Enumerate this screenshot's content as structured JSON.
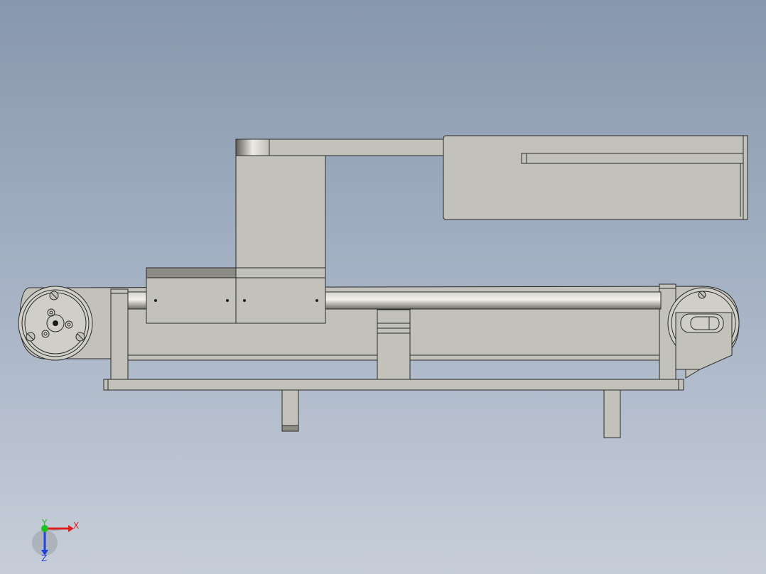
{
  "viewport": {
    "background_top": "#8797ad",
    "background_bottom": "#c7ced9",
    "part_color": "#c2c1ba",
    "edge_color": "#2a2a2a"
  },
  "triad": {
    "x_label": "X",
    "y_label": "Y",
    "z_label": "Z",
    "x_color": "#e02020",
    "y_color": "#20c020",
    "z_color": "#2040e0"
  }
}
